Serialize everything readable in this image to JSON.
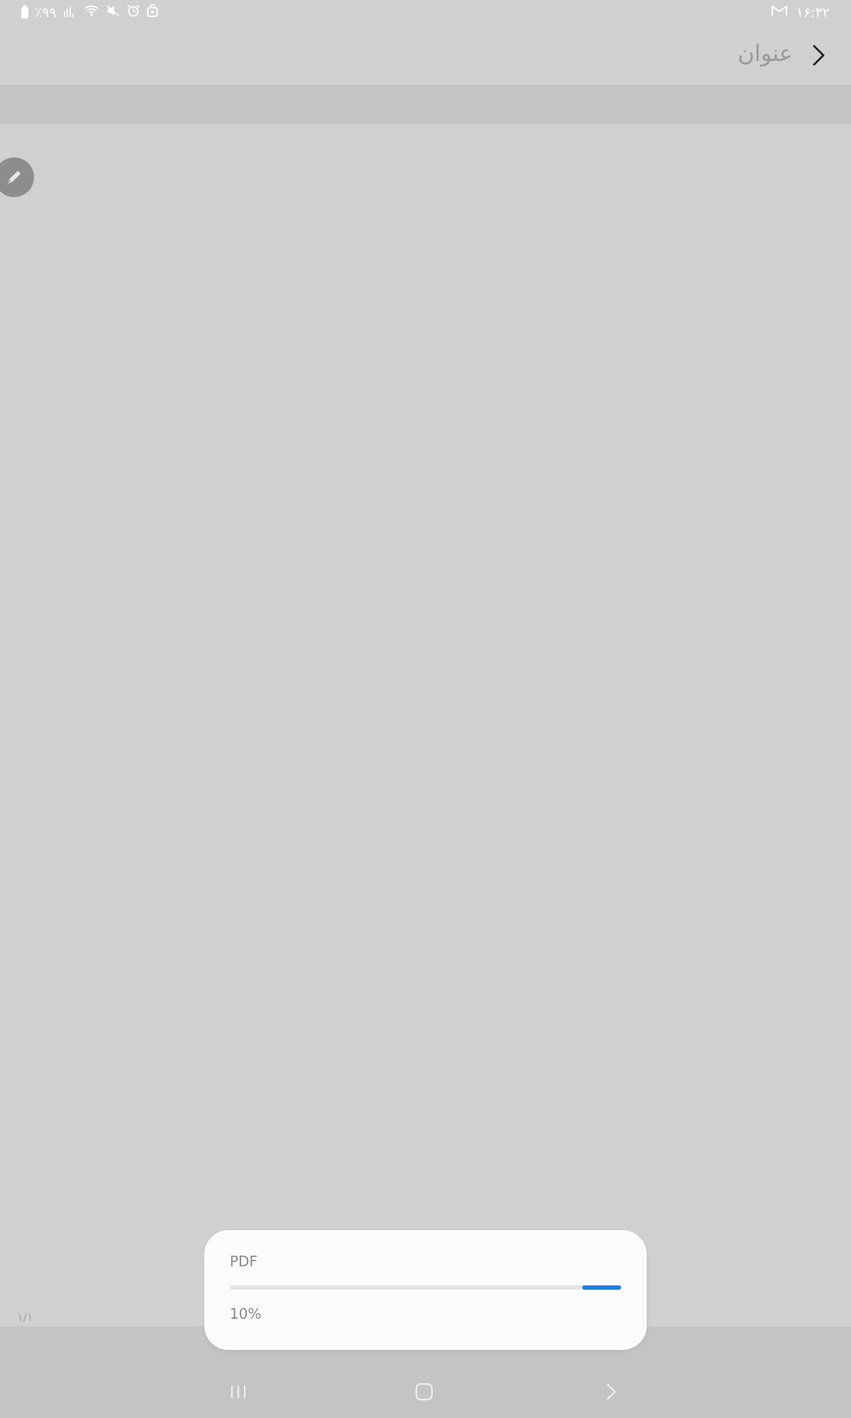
{
  "status_bar": {
    "battery_text": "٪۹۹",
    "time": "۱۶:۳۲",
    "icons": [
      "battery-icon",
      "signal-icon",
      "wifi-icon",
      "mute-icon",
      "alarm-icon",
      "lock-icon",
      "gmail-icon"
    ]
  },
  "app_bar": {
    "title": "عنوان",
    "back_icon": "chevron-right-icon"
  },
  "fab": {
    "icon": "pencil-icon"
  },
  "page_indicator": "۱/۱",
  "progress_dialog": {
    "title": "PDF",
    "percent_label": "10%",
    "progress_fraction": 0.1,
    "accent_color": "#1a7fe6"
  },
  "nav_bar": {
    "recents_icon": "recents-icon",
    "home_icon": "home-icon",
    "back_icon": "back-icon"
  }
}
